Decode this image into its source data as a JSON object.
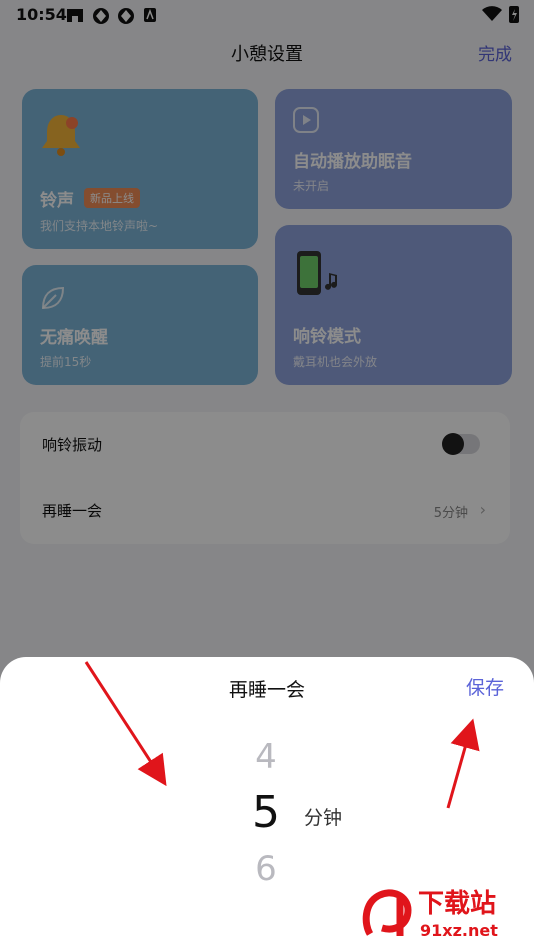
{
  "status_bar": {
    "time": "10:54"
  },
  "header": {
    "title": "小憩设置",
    "done": "完成"
  },
  "cards": [
    {
      "title": "铃声",
      "badge": "新品上线",
      "subtitle": "我们支持本地铃声啦~",
      "icon": "bell-icon"
    },
    {
      "title": "自动播放助眠音",
      "subtitle": "未开启",
      "icon": "play-icon"
    },
    {
      "title": "无痛唤醒",
      "subtitle": "提前15秒",
      "icon": "leaf-icon"
    },
    {
      "title": "响铃模式",
      "subtitle": "戴耳机也会外放",
      "icon": "phone-music-icon"
    }
  ],
  "settings": [
    {
      "label": "响铃振动",
      "toggle_on": false
    },
    {
      "label": "再睡一会",
      "value": "5分钟"
    }
  ],
  "sheet": {
    "title": "再睡一会",
    "save": "保存",
    "picker": {
      "prev": "4",
      "current": "5",
      "next": "6",
      "unit": "分钟"
    }
  },
  "watermark": {
    "brand": "下载站",
    "site": "91xz.net"
  },
  "colors": {
    "accent": "#5b63d8",
    "badge": "#f08c56",
    "card_blue": "#7cb4d8",
    "card_periwinkle": "#8ea3dc"
  }
}
